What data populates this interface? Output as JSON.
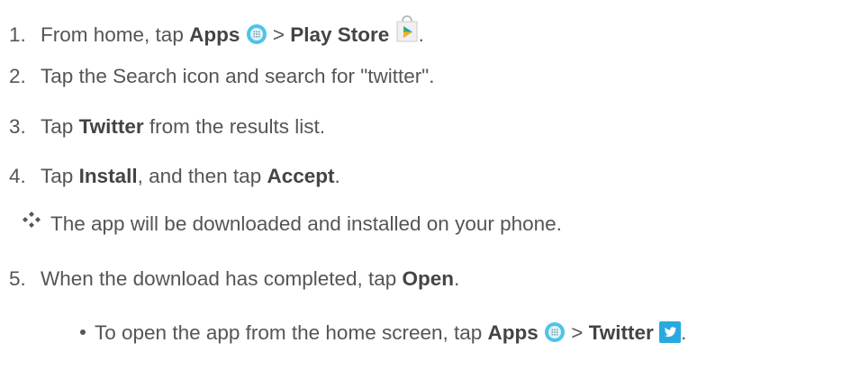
{
  "steps": [
    {
      "num": "1.",
      "t1": "From home, tap ",
      "b1": "Apps",
      "t2": " > ",
      "b2": "Play Store",
      "t3": "."
    },
    {
      "num": "2.",
      "t1": "Tap the Search icon and search for \"twitter\"."
    },
    {
      "num": "3.",
      "t1": "Tap ",
      "b1": "Twitter",
      "t2": " from the results list."
    },
    {
      "num": "4.",
      "t1": "Tap ",
      "b1": "Install",
      "t2": ", and then tap ",
      "b2": "Accept",
      "t3": "."
    },
    {
      "num": "5.",
      "t1": "When the download has completed, tap ",
      "b1": "Open",
      "t2": "."
    }
  ],
  "result_note": "The app will be downloaded and installed on your phone.",
  "sub_bullet": {
    "t1": "To open the app from the home screen, tap ",
    "b1": "Apps",
    "t2": " > ",
    "b2": "Twitter",
    "t3": "."
  },
  "icons": {
    "apps": "apps-icon",
    "play_store": "play-store-icon",
    "twitter": "twitter-icon",
    "result": "diamond-bullet-icon"
  },
  "colors": {
    "text": "#555555",
    "bold": "#444444",
    "apps_icon": "#4fc3e8",
    "twitter_icon": "#2aa9e0"
  }
}
